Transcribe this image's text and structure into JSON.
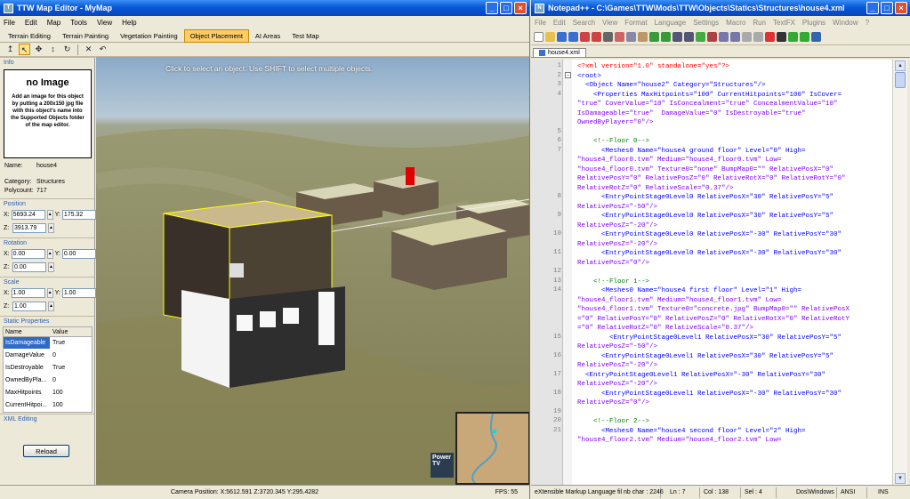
{
  "editor": {
    "title": "TTW Map Editor - MyMap",
    "menu": [
      "File",
      "Edit",
      "Map",
      "Tools",
      "View",
      "Help"
    ],
    "tabs": [
      "Terrain Editing",
      "Terrain Painting",
      "Vegetation Painting",
      "Object Placement",
      "AI Areas",
      "Test Map"
    ],
    "active_tab": "Object Placement",
    "info_label": "Info",
    "no_image_title": "no Image",
    "no_image_text": "Add an image for this object by putting a 200x150 jpg file with this object's name into the Supported Objects folder of the map editor.",
    "name_label": "Name:",
    "name_value": "house4",
    "category_label": "Category:",
    "category_value": "Structures",
    "polycount_label": "Polycount:",
    "polycount_value": "717",
    "position_label": "Position",
    "pos_x": "5693.24",
    "pos_y": "175.32",
    "pos_z": "3913.79",
    "rotation_label": "Rotation",
    "rot_x": "0.00",
    "rot_y": "0.00",
    "rot_z": "0.00",
    "scale_label": "Scale",
    "scale_x": "1.00",
    "scale_y": "1.00",
    "scale_z": "1.00",
    "static_props_label": "Static Properties",
    "col_name": "Name",
    "col_value": "Value",
    "properties": [
      {
        "name": "IsDamageable",
        "value": "True"
      },
      {
        "name": "DamageValue",
        "value": "0"
      },
      {
        "name": "IsDestroyable",
        "value": "True"
      },
      {
        "name": "OwnedByPla...",
        "value": "0"
      },
      {
        "name": "MaxHitpoints",
        "value": "100"
      },
      {
        "name": "CurrentHitpoi...",
        "value": "100"
      }
    ],
    "xml_editing_label": "XML Editing",
    "reload_label": "Reload",
    "viewport_hint": "Click to select an object. Use SHIFT to select multiple objects.",
    "camera_position": "Camera Position:  X:5612.591  Z:3720.345  Y:295.4282",
    "fps": "FPS: 55",
    "brand_text": "Power TV"
  },
  "notepad": {
    "title": "Notepad++ - C:\\Games\\TTW\\Mods\\TTW\\Objects\\Statics\\Structures\\house4.xml",
    "menu": [
      "File",
      "Edit",
      "Search",
      "View",
      "Format",
      "Language",
      "Settings",
      "Macro",
      "Run",
      "TextFX",
      "Plugins",
      "Window",
      "?"
    ],
    "doc_tab": "house4.xml",
    "lines": [
      {
        "n": "1",
        "fold": "",
        "text": "<?xml version=\"1.0\" standalone=\"yes\"?>"
      },
      {
        "n": "2",
        "fold": "-",
        "text": "<root>"
      },
      {
        "n": "3",
        "fold": "",
        "text": "  <Object Name=\"house2\" Category=\"Structures\"/>"
      },
      {
        "n": "4",
        "fold": "",
        "text": "    <Properties MaxHitpoints=\"100\" CurrentHitpoints=\"100\" IsCover="
      },
      {
        "n": "",
        "fold": "",
        "text": "\"true\" CoverValue=\"10\" IsConcealment=\"true\" ConcealmentValue=\"10\""
      },
      {
        "n": "",
        "fold": "",
        "text": "IsDamageable=\"true\"  DamageValue=\"0\" IsDestroyable=\"true\""
      },
      {
        "n": "",
        "fold": "",
        "text": "OwnedByPlayer=\"0\"/>"
      },
      {
        "n": "5",
        "fold": "",
        "text": ""
      },
      {
        "n": "6",
        "fold": "",
        "text": "    <!--Floor 0-->"
      },
      {
        "n": "7",
        "fold": "",
        "text": "      <Meshes0 Name=\"house4 ground floor\" Level=\"0\" High="
      },
      {
        "n": "",
        "fold": "",
        "text": "\"house4_floor0.tvm\" Medium=\"house4_floor0.tvm\" Low="
      },
      {
        "n": "",
        "fold": "",
        "text": "\"house4_floor0.tvm\" Texture0=\"none\" BumpMap0=\"\" RelativePosX=\"0\""
      },
      {
        "n": "",
        "fold": "",
        "text": "RelativePosY=\"0\" RelativePosZ=\"0\" RelativeRotX=\"0\" RelativeRotY=\"0\""
      },
      {
        "n": "",
        "fold": "",
        "text": "RelativeRotZ=\"0\" RelativeScale=\"0.37\"/>"
      },
      {
        "n": "8",
        "fold": "",
        "text": "      <EntryPointStage0Level0 RelativePosX=\"30\" RelativePosY=\"5\""
      },
      {
        "n": "",
        "fold": "",
        "text": "RelativePosZ=\"-50\"/>"
      },
      {
        "n": "9",
        "fold": "",
        "text": "      <EntryPointStage0Level0 RelativePosX=\"30\" RelativePosY=\"5\""
      },
      {
        "n": "",
        "fold": "",
        "text": "RelativePosZ=\"-20\"/>"
      },
      {
        "n": "10",
        "fold": "",
        "text": "      <EntryPointStage0Level0 RelativePosX=\"-30\" RelativePosY=\"30\""
      },
      {
        "n": "",
        "fold": "",
        "text": "RelativePosZ=\"-20\"/>"
      },
      {
        "n": "11",
        "fold": "",
        "text": "      <EntryPointStage0Level0 RelativePosX=\"-30\" RelativePosY=\"30\""
      },
      {
        "n": "",
        "fold": "",
        "text": "RelativePosZ=\"0\"/>"
      },
      {
        "n": "12",
        "fold": "",
        "text": ""
      },
      {
        "n": "13",
        "fold": "",
        "text": "    <!--Floor 1-->"
      },
      {
        "n": "14",
        "fold": "",
        "text": "      <Meshes0 Name=\"house4 first floor\" Level=\"1\" High="
      },
      {
        "n": "",
        "fold": "",
        "text": "\"house4_floor1.tvm\" Medium=\"house4_floor1.tvm\" Low="
      },
      {
        "n": "",
        "fold": "",
        "text": "\"house4_floor1.tvm\" Texture0=\"concrete.jpg\" BumpMap0=\"\" RelativePosX"
      },
      {
        "n": "",
        "fold": "",
        "text": "=\"0\" RelativePosY=\"0\" RelativePosZ=\"0\" RelativeRotX=\"0\" RelativeRotY"
      },
      {
        "n": "",
        "fold": "",
        "text": "=\"0\" RelativeRotZ=\"0\" RelativeScale=\"0.37\"/>"
      },
      {
        "n": "15",
        "fold": "",
        "text": "        <EntryPointStage0Level1 RelativePosX=\"30\" RelativePosY=\"5\""
      },
      {
        "n": "",
        "fold": "",
        "text": "RelativePosZ=\"-50\"/>"
      },
      {
        "n": "16",
        "fold": "",
        "text": "      <EntryPointStage0Level1 RelativePosX=\"30\" RelativePosY=\"5\""
      },
      {
        "n": "",
        "fold": "",
        "text": "RelativePosZ=\"-20\"/>"
      },
      {
        "n": "17",
        "fold": "",
        "text": "  <EntryPointStage0Level1 RelativePosX=\"-30\" RelativePosY=\"30\""
      },
      {
        "n": "",
        "fold": "",
        "text": "RelativePosZ=\"-20\"/>"
      },
      {
        "n": "18",
        "fold": "",
        "text": "      <EntryPointStage0Level1 RelativePosX=\"-30\" RelativePosY=\"30\""
      },
      {
        "n": "",
        "fold": "",
        "text": "RelativePosZ=\"0\"/>"
      },
      {
        "n": "19",
        "fold": "",
        "text": ""
      },
      {
        "n": "20",
        "fold": "",
        "text": "    <!--Floor 2-->"
      },
      {
        "n": "21",
        "fold": "",
        "text": "      <Meshes0 Name=\"house4 second floor\" Level=\"2\" High="
      },
      {
        "n": "",
        "fold": "",
        "text": "\"house4_floor2.tvm\" Medium=\"house4_floor2.tvm\" Low="
      }
    ],
    "status": {
      "type": "eXtensible Markup Language fil nb char : 2246",
      "ln": "Ln : 7",
      "col": "Col : 138",
      "sel": "Sel : 4",
      "eol": "Dos\\Windows",
      "enc": "ANSI",
      "ins": "INS"
    }
  }
}
